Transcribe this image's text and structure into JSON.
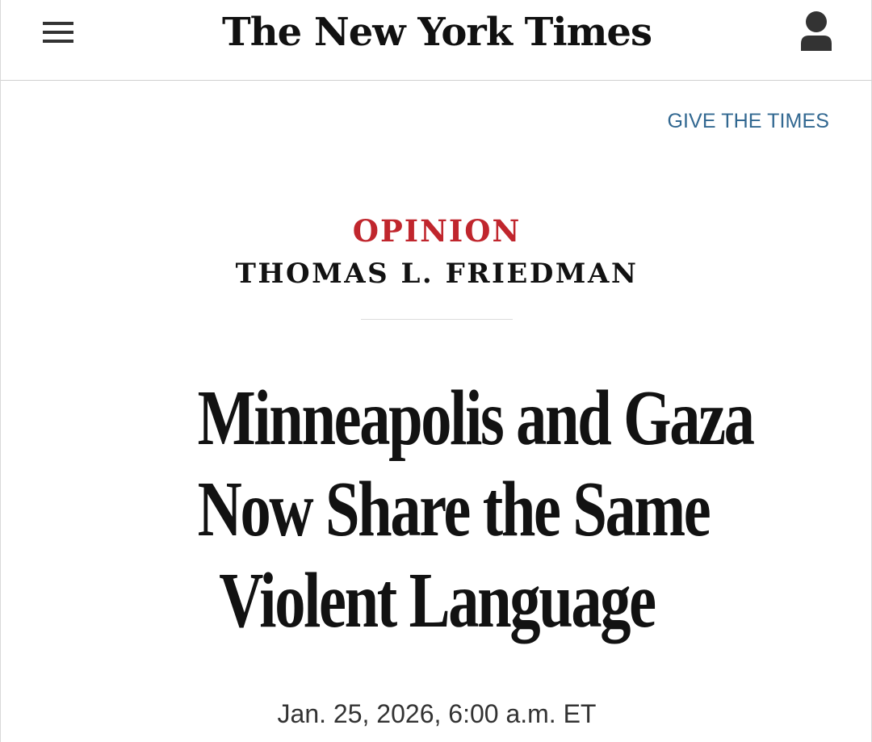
{
  "header": {
    "logo_text": "The New York Times",
    "menu_icon": "hamburger-menu-icon",
    "account_icon": "user-account-icon"
  },
  "promo": {
    "give_link_label": "GIVE THE TIMES",
    "color": "#326891"
  },
  "article": {
    "section": "OPINION",
    "section_color": "#c0262d",
    "author": "THOMAS L. FRIEDMAN",
    "headline_lines": [
      "Minneapolis and Gaza",
      "Now Share the Same",
      "Violent Language"
    ],
    "date": "Jan. 25, 2026, 6:00 a.m. ET"
  }
}
